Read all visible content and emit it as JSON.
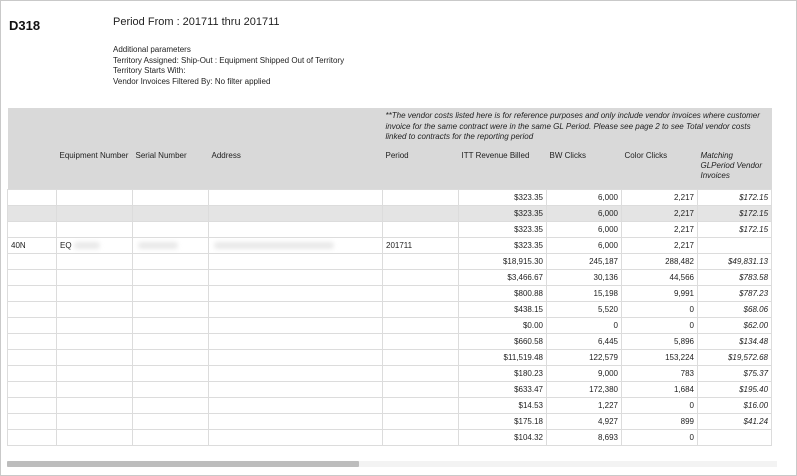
{
  "report": {
    "id": "D318",
    "period_line": "Period From : 201711 thru 201711",
    "params": [
      "Additional parameters",
      "Territory Assigned: Ship-Out : Equipment Shipped Out of Territory",
      "Territory Starts With:",
      "Vendor Invoices Filtered By: No filter applied"
    ]
  },
  "table": {
    "note": "**The vendor costs listed here is for reference purposes and only include vendor invoices where customer invoice for the same contract were in the same GL Period. Please see page 2 to see Total vendor costs linked to contracts for the reporting period",
    "headers": [
      "",
      "Equipment Number",
      "Serial Number",
      "Address",
      "Period",
      "ITT Revenue Billed",
      "BW Clicks",
      "Color Clicks",
      "Matching GLPeriod Vendor Invoices"
    ],
    "rows": [
      [
        "",
        "",
        "",
        "",
        "",
        "$323.35",
        "6,000",
        "2,217",
        "$172.15"
      ],
      [
        "",
        "",
        "",
        "",
        "",
        "$323.35",
        "6,000",
        "2,217",
        "$172.15"
      ],
      [
        "",
        "",
        "",
        "",
        "",
        "$323.35",
        "6,000",
        "2,217",
        "$172.15"
      ],
      [
        "40N",
        "EQ",
        "",
        "",
        "201711",
        "$323.35",
        "6,000",
        "2,217",
        ""
      ],
      [
        "",
        "",
        "",
        "",
        "",
        "$18,915.30",
        "245,187",
        "288,482",
        "$49,831.13"
      ],
      [
        "",
        "",
        "",
        "",
        "",
        "$3,466.67",
        "30,136",
        "44,566",
        "$783.58"
      ],
      [
        "",
        "",
        "",
        "",
        "",
        "$800.88",
        "15,198",
        "9,991",
        "$787.23"
      ],
      [
        "",
        "",
        "",
        "",
        "",
        "$438.15",
        "5,520",
        "0",
        "$68.06"
      ],
      [
        "",
        "",
        "",
        "",
        "",
        "$0.00",
        "0",
        "0",
        "$62.00"
      ],
      [
        "",
        "",
        "",
        "",
        "",
        "$660.58",
        "6,445",
        "5,896",
        "$134.48"
      ],
      [
        "",
        "",
        "",
        "",
        "",
        "$11,519.48",
        "122,579",
        "153,224",
        "$19,572.68"
      ],
      [
        "",
        "",
        "",
        "",
        "",
        "$180.23",
        "9,000",
        "783",
        "$75.37"
      ],
      [
        "",
        "",
        "",
        "",
        "",
        "$633.47",
        "172,380",
        "1,684",
        "$195.40"
      ],
      [
        "",
        "",
        "",
        "",
        "",
        "$14.53",
        "1,227",
        "0",
        "$16.00"
      ],
      [
        "",
        "",
        "",
        "",
        "",
        "$175.18",
        "4,927",
        "899",
        "$41.24"
      ],
      [
        "",
        "",
        "",
        "",
        "",
        "$104.32",
        "8,693",
        "0",
        ""
      ]
    ]
  }
}
